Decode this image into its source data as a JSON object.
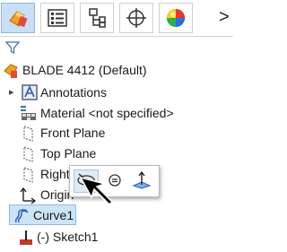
{
  "toolbar": {
    "tabs": [
      {
        "name": "feature-manager-tab",
        "icon": "part-tree-icon"
      },
      {
        "name": "property-manager-tab",
        "icon": "property-manager-icon"
      },
      {
        "name": "configuration-manager-tab",
        "icon": "configuration-manager-icon"
      },
      {
        "name": "dimxpert-manager-tab",
        "icon": "target-crosshair-icon"
      },
      {
        "name": "display-manager-tab",
        "icon": "appearance-sphere-icon"
      }
    ],
    "more_label": ">"
  },
  "tree": {
    "root": {
      "label": "BLADE 4412  (Default)",
      "icon": "part-icon"
    },
    "items": [
      {
        "label": "Annotations",
        "icon": "annotations-icon",
        "has_caret": true
      },
      {
        "label": "Material <not specified>",
        "icon": "material-icon"
      },
      {
        "label": "Front Plane",
        "icon": "plane-icon"
      },
      {
        "label": "Top Plane",
        "icon": "plane-icon"
      },
      {
        "label": "Right",
        "icon": "plane-icon"
      },
      {
        "label": "Origin",
        "icon": "origin-icon"
      },
      {
        "label": "Curve1",
        "icon": "curve-icon",
        "selected": true
      },
      {
        "label": "(-) Sketch1",
        "icon": "sketch-icon"
      }
    ]
  },
  "popup": {
    "buttons": [
      {
        "name": "hide-show-button",
        "icon": "eye-hide-icon"
      },
      {
        "name": "edit-feature-button",
        "icon": "edit-feature-icon"
      },
      {
        "name": "normal-to-button",
        "icon": "normal-to-icon"
      }
    ]
  },
  "colors": {
    "accent": "#f0a020",
    "selection": "#cde3f7",
    "active_tab": "#c9dff5"
  }
}
